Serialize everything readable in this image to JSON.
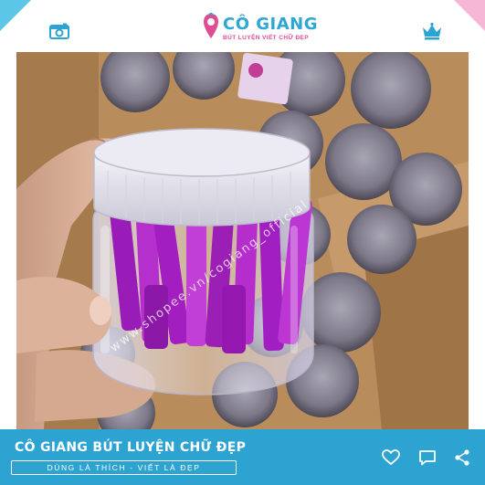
{
  "header": {
    "logo_title": "CÔ GIANG",
    "logo_subtitle": "BÚT LUYỆN VIẾT CHỮ ĐẸP",
    "left_icon": "camera-icon",
    "right_icon": "crown-icon"
  },
  "photo": {
    "watermark": "www.shopee.vn/cogiang_official"
  },
  "footer": {
    "title": "CÔ GIANG BÚT LUYỆN CHỮ ĐẸP",
    "slogan": "DÙNG LÀ THÍCH - VIẾT LÀ ĐẸP",
    "icons": [
      "heart-icon",
      "chat-icon",
      "share-icon"
    ]
  },
  "colors": {
    "brand_blue": "#2da3d2",
    "brand_pink": "#e04c92",
    "ink_purple": "#a21ec0"
  }
}
